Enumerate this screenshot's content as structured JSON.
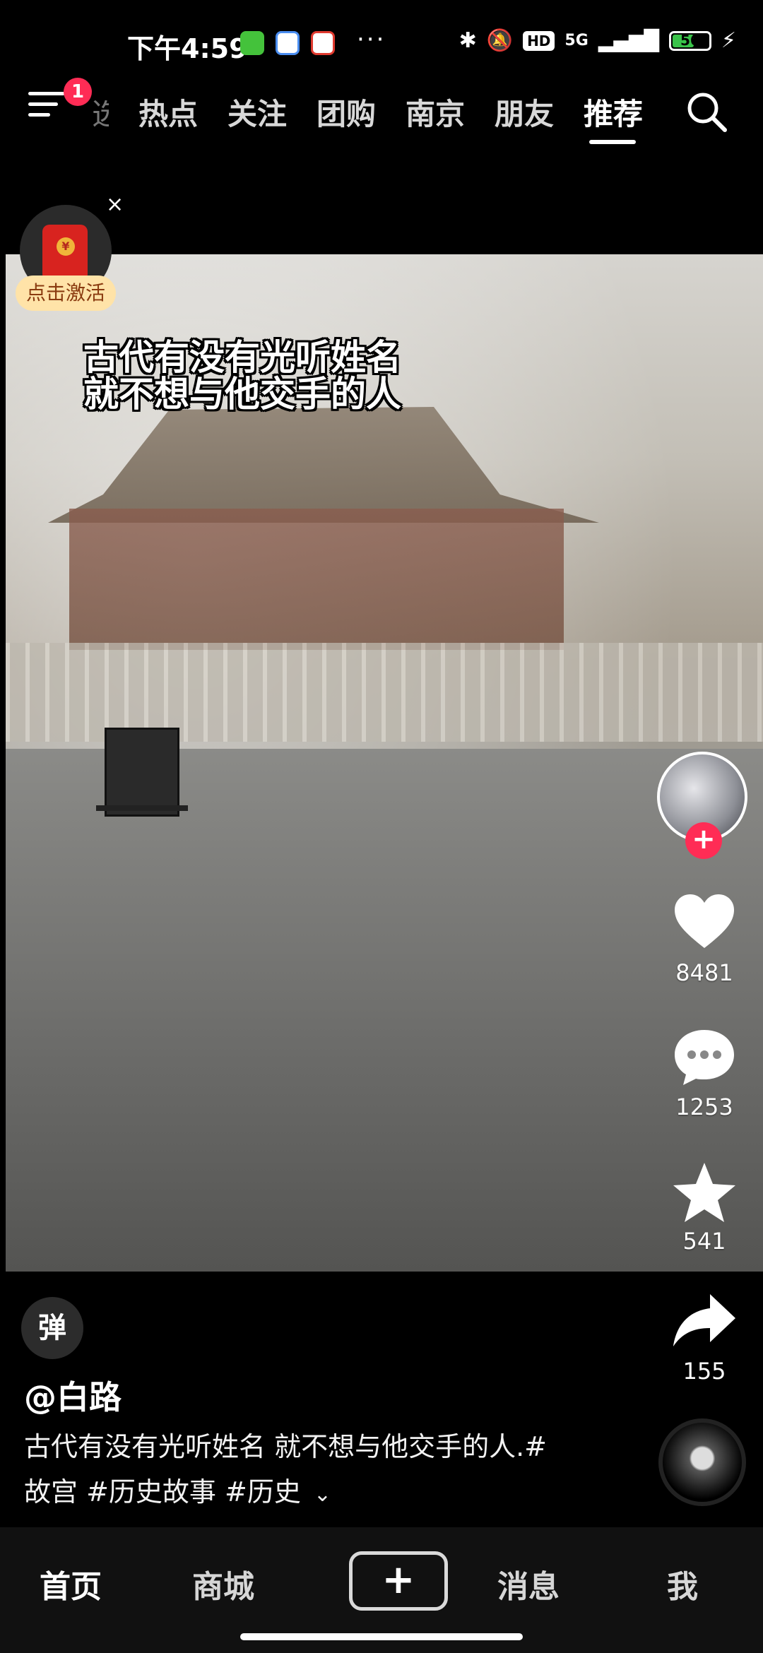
{
  "status_bar": {
    "time": "下午4:59",
    "more": "···",
    "network": "5G",
    "hd": "HD",
    "battery": "56"
  },
  "top_nav": {
    "badge": "1",
    "partial_tab": "选",
    "tabs": [
      "热点",
      "关注",
      "团购",
      "南京",
      "朋友",
      "推荐"
    ],
    "active_tab": "推荐"
  },
  "red_packet": {
    "coin": "¥",
    "close": "×",
    "button": "点击激活"
  },
  "video": {
    "caption_line1": "古代有没有光听姓名",
    "caption_line2": "就不想与他交手的人"
  },
  "actions": {
    "follow": "+",
    "likes": "8481",
    "comments": "1253",
    "favorites": "541",
    "shares": "155"
  },
  "post": {
    "danmu": "弹",
    "author": "@白路",
    "desc_line1": "古代有没有光听姓名 就不想与他交手的人.#",
    "desc_line2": "故宫 #历史故事 #历史",
    "expand": "⌄"
  },
  "tabbar": {
    "home": "首页",
    "mall": "商城",
    "add": "+",
    "messages": "消息",
    "me": "我"
  }
}
